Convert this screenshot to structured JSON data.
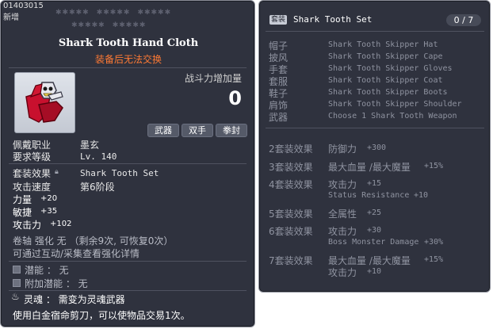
{
  "header": {
    "item_id": "01403015",
    "new_label": "新增"
  },
  "item": {
    "name": "Shark Tooth Hand Cloth",
    "trade_note": "装备后无法交换",
    "power_label": "战斗力增加量",
    "power_value": "0",
    "tags": [
      "武器",
      "双手",
      "拳封"
    ]
  },
  "requirements": [
    {
      "label": "佩戴职业",
      "value": "墨玄"
    },
    {
      "label": "要求等级",
      "value": "Lv. 140"
    }
  ],
  "info": {
    "set_label": "套装效果",
    "set_value": "Shark Tooth Set",
    "speed_label": "攻击速度",
    "speed_value": "第6阶段"
  },
  "stats": [
    {
      "label": "力量",
      "value": "+20"
    },
    {
      "label": "敏捷",
      "value": "+35"
    },
    {
      "label": "攻击力",
      "value": "+102"
    }
  ],
  "upgrade": {
    "line1": "卷轴 强化 无 （剩余9次, 可恢复0次）",
    "line2": "可通过互动/采集查看强化详情"
  },
  "potential": {
    "label": "潜能 ： 无",
    "bonus_label": "附加潜能 ： 无"
  },
  "soul": {
    "label": "灵魂 ： 需变为灵魂武器",
    "note": "使用白金宿命剪刀，可以使物品交易1次。"
  },
  "set_panel": {
    "badge": "套装",
    "name": "Shark Tooth Set",
    "count": "0 / 7",
    "pieces": [
      {
        "slot": "帽子",
        "name": "Shark Tooth Skipper Hat"
      },
      {
        "slot": "披风",
        "name": "Shark Tooth Skipper Cape"
      },
      {
        "slot": "手套",
        "name": "Shark Tooth Skipper Gloves"
      },
      {
        "slot": "套服",
        "name": "Shark Tooth Skipper Coat"
      },
      {
        "slot": "鞋子",
        "name": "Shark Tooth Skipper Boots"
      },
      {
        "slot": "肩饰",
        "name": "Shark Tooth Skipper Shoulder"
      },
      {
        "slot": "武器",
        "name": "Choose 1 Shark Tooth Weapon"
      }
    ],
    "effects": [
      {
        "label": "2套装效果",
        "lines": [
          {
            "stat": "防御力",
            "value": "+300"
          }
        ]
      },
      {
        "label": "3套装效果",
        "lines": [
          {
            "stat": "最大血量 /最大魔量",
            "value": "+15%"
          }
        ]
      },
      {
        "label": "4套装效果",
        "lines": [
          {
            "stat": "攻击力",
            "value": "+15"
          },
          {
            "stat": "Status Resistance",
            "value": "+10"
          }
        ]
      },
      {
        "label": "5套装效果",
        "lines": [
          {
            "stat": "全属性",
            "value": "+25"
          }
        ]
      },
      {
        "label": "6套装效果",
        "lines": [
          {
            "stat": "攻击力",
            "value": "+30"
          },
          {
            "stat": "Boss Monster Damage",
            "value": "+30%"
          }
        ]
      },
      {
        "label": "7套装效果",
        "lines": [
          {
            "stat": "最大血量 /最大魔量",
            "value": "+15%"
          },
          {
            "stat": "攻击力",
            "value": "+10"
          }
        ]
      }
    ]
  }
}
